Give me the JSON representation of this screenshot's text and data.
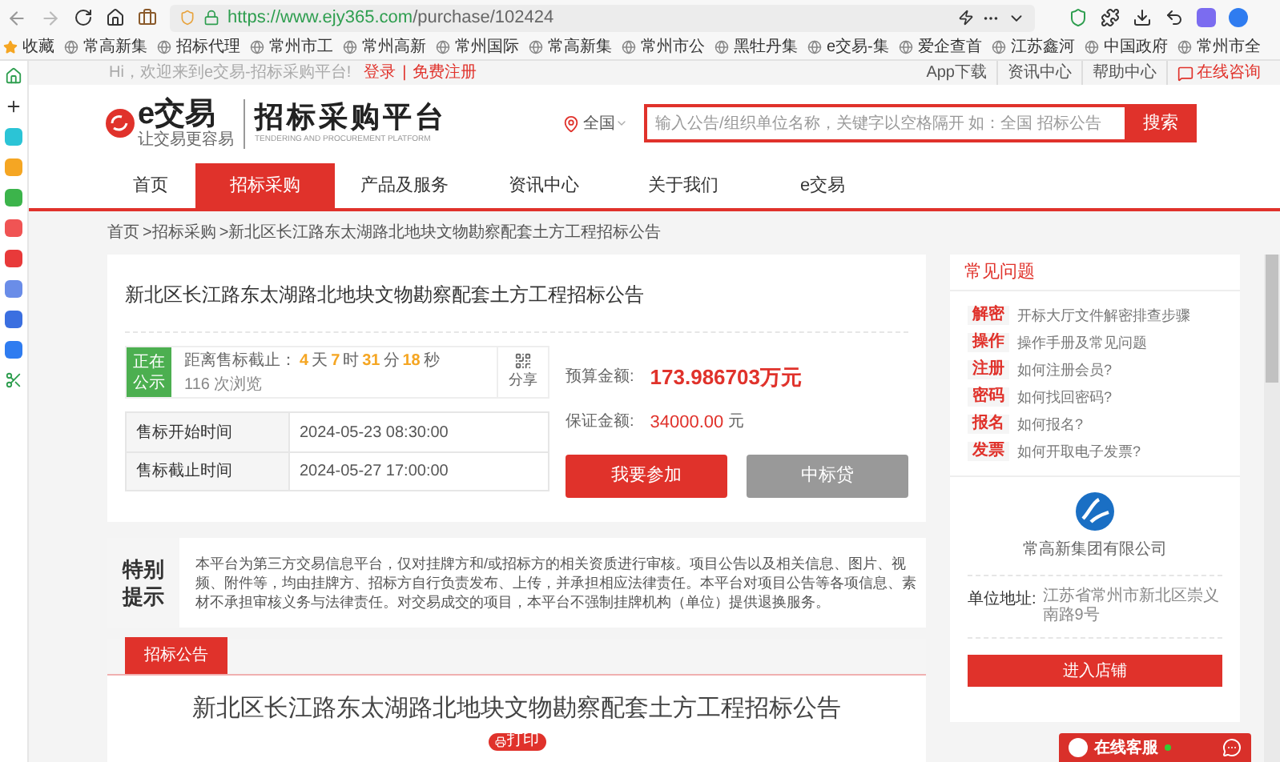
{
  "browser": {
    "url_host": "https://www.ejy365.com",
    "url_path": "/purchase/102424",
    "bookmarks": [
      "收藏",
      "常高新集",
      "招标代理",
      "常州市工",
      "常州高新",
      "常州国际",
      "常高新集",
      "常州市公",
      "黑牡丹集",
      "e交易-集",
      "爱企查首",
      "江苏鑫河",
      "中国政府",
      "常州市全"
    ]
  },
  "top_bar": {
    "greeting": "Hi，欢迎来到e交易-招标采购平台!",
    "login": "登录",
    "separator": "|",
    "register": "免费注册",
    "links": [
      "App下载",
      "资讯中心",
      "帮助中心"
    ],
    "consult": "在线咨询"
  },
  "header": {
    "logo_text": "e交易",
    "logo_slogan": "让交易更容易",
    "platform_title": "招标采购平台",
    "platform_subtitle": "TENDERING AND PROCUREMENT PLATFORM",
    "region": "全国",
    "search": {
      "placeholder": "输入公告/组织单位名称，关键字以空格隔开 如：全国 招标公告"
    },
    "search_button": "搜索"
  },
  "nav": [
    {
      "label": "首页",
      "selected": false
    },
    {
      "label": "招标采购",
      "selected": true
    },
    {
      "label": "产品及服务",
      "selected": false
    },
    {
      "label": "资讯中心",
      "selected": false
    },
    {
      "label": "关于我们",
      "selected": false
    },
    {
      "label": "e交易",
      "selected": false
    }
  ],
  "breadcrumb": [
    "首页",
    ">招标采购",
    ">新北区长江路东太湖路北地块文物勘察配套土方工程招标公告"
  ],
  "notice": {
    "title": "新北区长江路东太湖路北地块文物勘察配套土方工程招标公告",
    "status": "正在公示",
    "countdown_label": "距离售标截止：",
    "countdown": [
      {
        "value": "4",
        "unit": "天"
      },
      {
        "value": "7",
        "unit": "时"
      },
      {
        "value": "31",
        "unit": "分"
      },
      {
        "value": "18",
        "unit": "秒"
      }
    ],
    "views": "116 次浏览",
    "share": "分享",
    "times": [
      {
        "label": "售标开始时间",
        "value": "2024-05-23 08:30:00"
      },
      {
        "label": "售标截止时间",
        "value": "2024-05-27 17:00:00"
      }
    ],
    "budget_label": "预算金额:",
    "budget": "173.986703万元",
    "deposit_label": "保证金额:",
    "deposit": "34000.00",
    "deposit_unit": "元",
    "join_button": "我要参加",
    "loan_button": "中标贷"
  },
  "tip": {
    "title": "特别提示",
    "text": "本平台为第三方交易信息平台，仅对挂牌方和/或招标方的相关资质进行审核。项目公告以及相关信息、图片、视频、附件等，均由挂牌方、招标方自行负责发布、上传，并承担相应法律责任。本平台对项目公告等各项信息、素材不承担审核义务与法律责任。对交易成交的项目，本平台不强制挂牌机构（单位）提供退换服务。"
  },
  "announcement": {
    "tabs": [
      {
        "label": "招标公告",
        "selected": true
      }
    ],
    "title": "新北区长江路东太湖路北地块文物勘察配套土方工程招标公告",
    "print": "打印"
  },
  "faq": {
    "title": "常见问题",
    "items": [
      {
        "tag": "解密",
        "text": "开标大厅文件解密排查步骤"
      },
      {
        "tag": "操作",
        "text": "操作手册及常见问题"
      },
      {
        "tag": "注册",
        "text": "如何注册会员?"
      },
      {
        "tag": "密码",
        "text": "如何找回密码?"
      },
      {
        "tag": "报名",
        "text": "如何报名?"
      },
      {
        "tag": "发票",
        "text": "如何开取电子发票?"
      }
    ]
  },
  "company": {
    "name": "常高新集团有限公司",
    "address_label": "单位地址:",
    "address": "江苏省常州市新北区崇义南路9号",
    "shop_button": "进入店铺"
  },
  "chat": {
    "label": "在线客服"
  }
}
